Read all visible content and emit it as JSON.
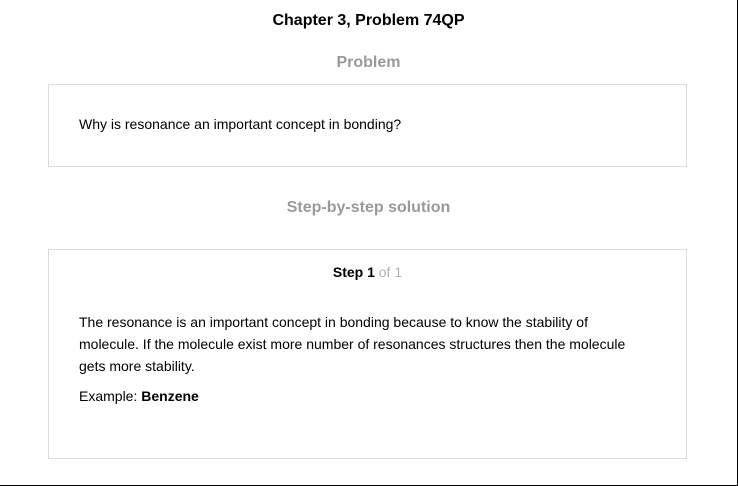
{
  "header": {
    "title": "Chapter 3, Problem 74QP"
  },
  "problem": {
    "heading": "Problem",
    "text": "Why is resonance an important concept in bonding?"
  },
  "solution": {
    "heading": "Step-by-step solution",
    "step": {
      "label": "Step 1",
      "of_text": " of 1",
      "body": "The resonance is an important concept in bonding because to know the stability of molecule. If the molecule exist more number of resonances structures then the molecule gets more stability.",
      "example_label": "Example: ",
      "example_value": "Benzene"
    }
  }
}
